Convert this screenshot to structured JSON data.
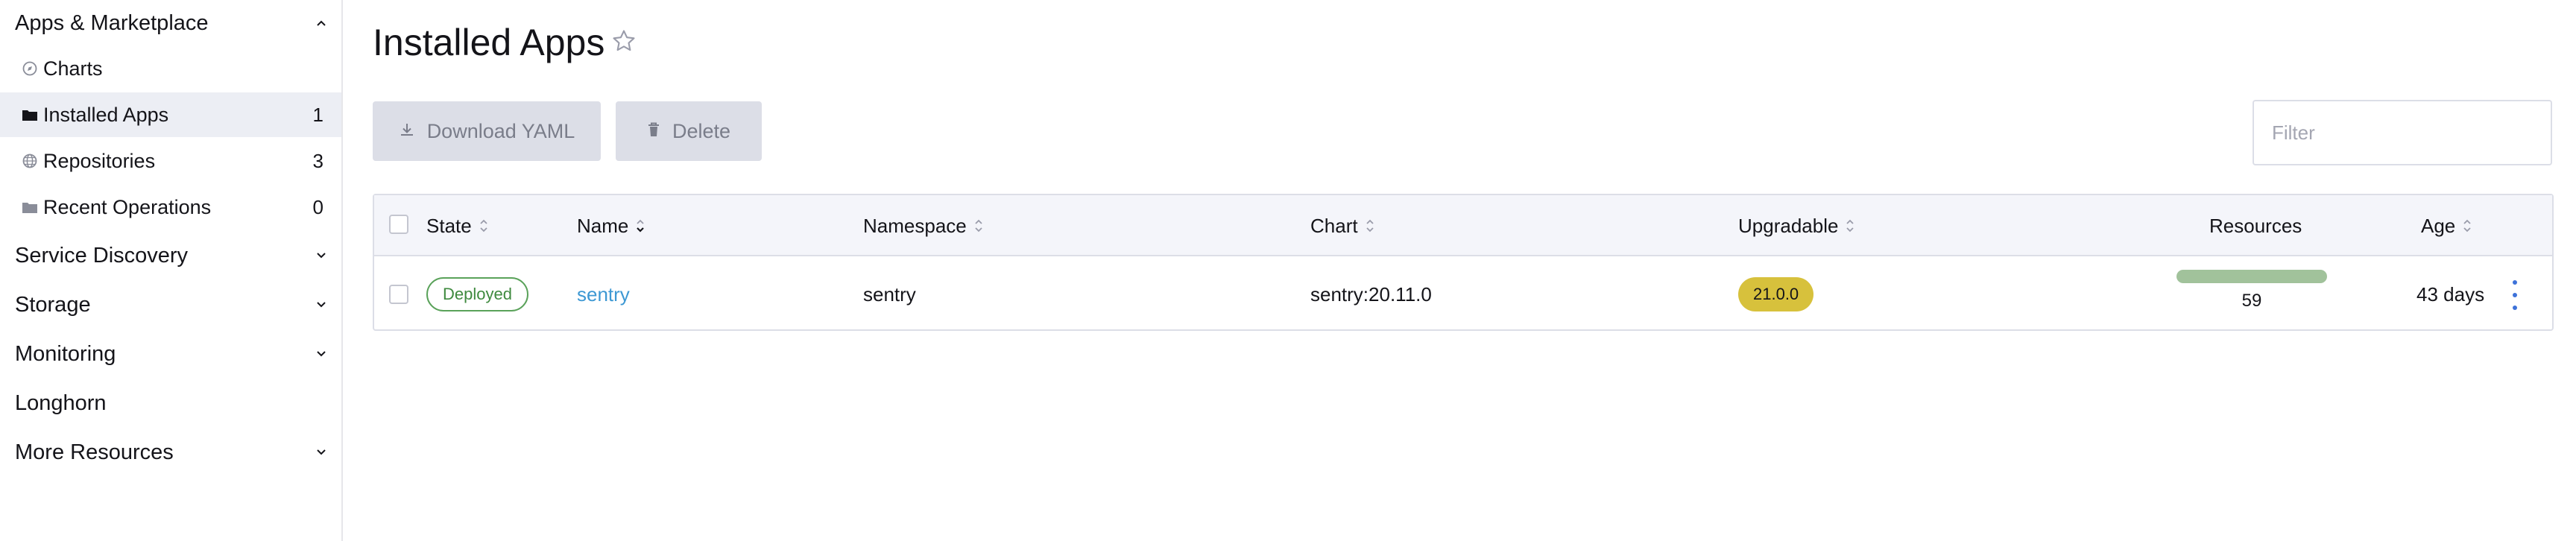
{
  "sidebar": {
    "groups": [
      {
        "label": "Apps & Marketplace",
        "expanded": true
      },
      {
        "label": "Service Discovery",
        "expanded": false
      },
      {
        "label": "Storage",
        "expanded": false
      },
      {
        "label": "Monitoring",
        "expanded": false
      },
      {
        "label": "Longhorn",
        "expanded": false
      },
      {
        "label": "More Resources",
        "expanded": false
      }
    ],
    "items": [
      {
        "label": "Charts",
        "icon": "compass-icon",
        "count": ""
      },
      {
        "label": "Installed Apps",
        "icon": "folder-icon",
        "count": "1",
        "active": true
      },
      {
        "label": "Repositories",
        "icon": "globe-icon",
        "count": "3"
      },
      {
        "label": "Recent Operations",
        "icon": "folder-icon",
        "count": "0"
      }
    ]
  },
  "page": {
    "title": "Installed Apps",
    "actions": {
      "download": "Download YAML",
      "delete": "Delete"
    },
    "filter_placeholder": "Filter"
  },
  "table": {
    "headers": {
      "state": "State",
      "name": "Name",
      "namespace": "Namespace",
      "chart": "Chart",
      "upgradable": "Upgradable",
      "resources": "Resources",
      "age": "Age"
    },
    "rows": [
      {
        "state": "Deployed",
        "name": "sentry",
        "namespace": "sentry",
        "chart": "sentry:20.11.0",
        "upgradable": "21.0.0",
        "resources": "59",
        "age": "43 days"
      }
    ]
  },
  "colors": {
    "accent": "#3d98d3",
    "deployed": "#5aa25a",
    "upgradable": "#d7c13c",
    "resources_bar": "#a1c29b",
    "sidebar_active": "#eceef4"
  }
}
